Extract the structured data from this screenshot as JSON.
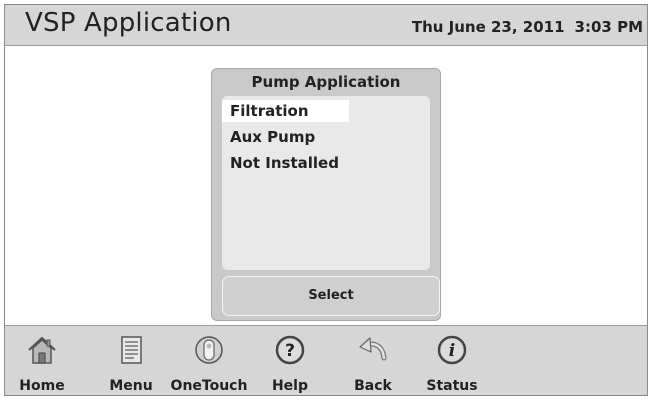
{
  "header": {
    "title": "VSP Application",
    "date": "Thu June 23, 2011",
    "time": "3:03 PM"
  },
  "panel": {
    "title": "Pump Application",
    "items": [
      {
        "label": "Filtration",
        "selected": true
      },
      {
        "label": "Aux Pump",
        "selected": false
      },
      {
        "label": "Not Installed",
        "selected": false
      }
    ],
    "select_label": "Select"
  },
  "toolbar": {
    "items": [
      {
        "label": "Home",
        "icon": "house-icon"
      },
      {
        "label": "Menu",
        "icon": "notepad-icon"
      },
      {
        "label": "OneTouch",
        "icon": "onetouch-icon"
      },
      {
        "label": "Help",
        "icon": "help-icon"
      },
      {
        "label": "Back",
        "icon": "back-arrow-icon"
      },
      {
        "label": "Status",
        "icon": "info-icon"
      }
    ]
  }
}
